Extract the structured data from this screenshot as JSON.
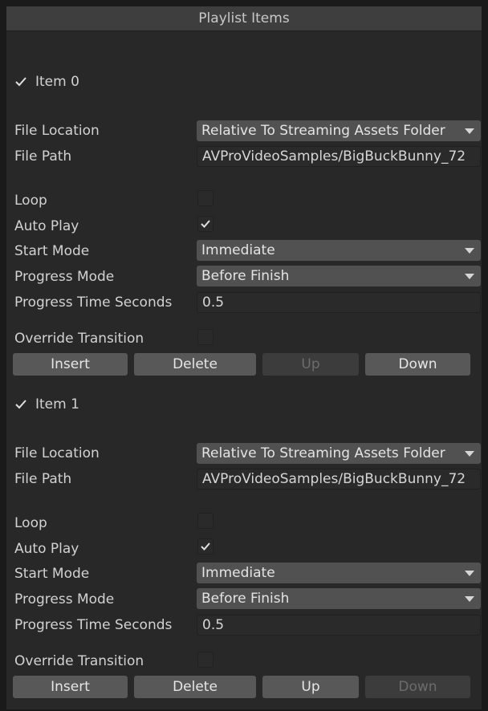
{
  "header": {
    "title": "Playlist Items"
  },
  "labels": {
    "file_location": "File Location",
    "file_path": "File Path",
    "loop": "Loop",
    "auto_play": "Auto Play",
    "start_mode": "Start Mode",
    "progress_mode": "Progress Mode",
    "progress_time_seconds": "Progress Time Seconds",
    "override_transition": "Override Transition"
  },
  "items": [
    {
      "title": "Item 0",
      "enabled": true,
      "file_location": "Relative To Streaming Assets Folder",
      "file_path": "AVProVideoSamples/BigBuckBunny_72",
      "loop": false,
      "auto_play": true,
      "start_mode": "Immediate",
      "progress_mode": "Before Finish",
      "progress_time_seconds": "0.5",
      "override_transition": false,
      "buttons": {
        "insert": "Insert",
        "delete": "Delete",
        "up": "Up",
        "down": "Down"
      },
      "up_enabled": false,
      "down_enabled": true
    },
    {
      "title": "Item 1",
      "enabled": true,
      "file_location": "Relative To Streaming Assets Folder",
      "file_path": "AVProVideoSamples/BigBuckBunny_72",
      "loop": false,
      "auto_play": true,
      "start_mode": "Immediate",
      "progress_mode": "Before Finish",
      "progress_time_seconds": "0.5",
      "override_transition": false,
      "buttons": {
        "insert": "Insert",
        "delete": "Delete",
        "up": "Up",
        "down": "Down"
      },
      "up_enabled": true,
      "down_enabled": false
    }
  ],
  "colors": {
    "background": "#282828",
    "header": "#3e3e3e",
    "button": "#585858",
    "button_disabled": "#3c3c3c",
    "dropdown": "#515151"
  }
}
